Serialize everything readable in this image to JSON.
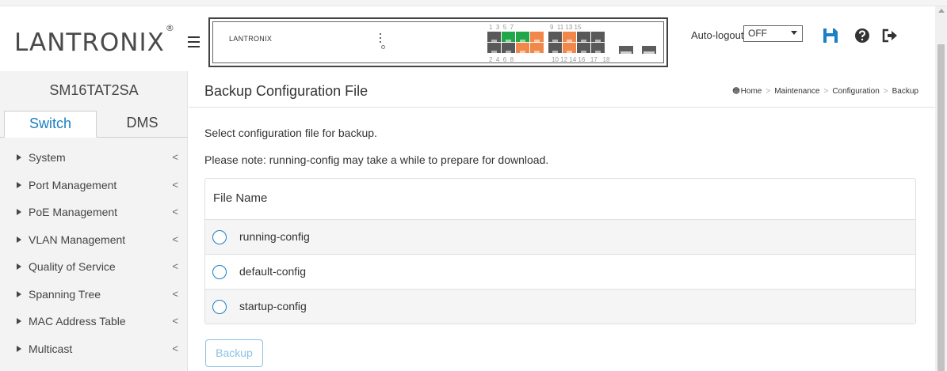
{
  "header": {
    "logo_text": "LANTRONIX",
    "logo_mark": "®",
    "device_panel": {
      "brand": "LANTRONIX",
      "port_numbers_top": "1 3 5 7 9 11 13 15",
      "port_numbers_bottom": "2 4 6 8 10 12 14 16 17 18",
      "colors": {
        "link_green": "#22a64a",
        "link_orange": "#f2874a",
        "port_idle": "#595959"
      }
    },
    "auto_logout_label": "Auto-logout",
    "auto_logout_value": "OFF",
    "icons": [
      "hamburger-icon",
      "save-icon",
      "help-icon",
      "logout-icon"
    ]
  },
  "sidebar": {
    "device_name": "SM16TAT2SA",
    "tabs": [
      {
        "label": "Switch",
        "active": true
      },
      {
        "label": "DMS",
        "active": false
      }
    ],
    "items": [
      {
        "label": "System"
      },
      {
        "label": "Port Management"
      },
      {
        "label": "PoE Management"
      },
      {
        "label": "VLAN Management"
      },
      {
        "label": "Quality of Service"
      },
      {
        "label": "Spanning Tree"
      },
      {
        "label": "MAC Address Table"
      },
      {
        "label": "Multicast"
      }
    ],
    "chevron": "<"
  },
  "main": {
    "title": "Backup Configuration File",
    "breadcrumb": [
      "Home",
      "Maintenance",
      "Configuration",
      "Backup"
    ],
    "description_1": "Select configuration file for backup.",
    "description_2": "Please note: running-config may take a while to prepare for download.",
    "table": {
      "header": "File Name",
      "rows": [
        {
          "name": "running-config",
          "selected": false
        },
        {
          "name": "default-config",
          "selected": false
        },
        {
          "name": "startup-config",
          "selected": false
        }
      ]
    },
    "backup_button": "Backup"
  },
  "colors": {
    "accent": "#1a7fc3",
    "button_disabled": "#8cc1e6",
    "sidebar_bg": "#f3f3f3"
  }
}
